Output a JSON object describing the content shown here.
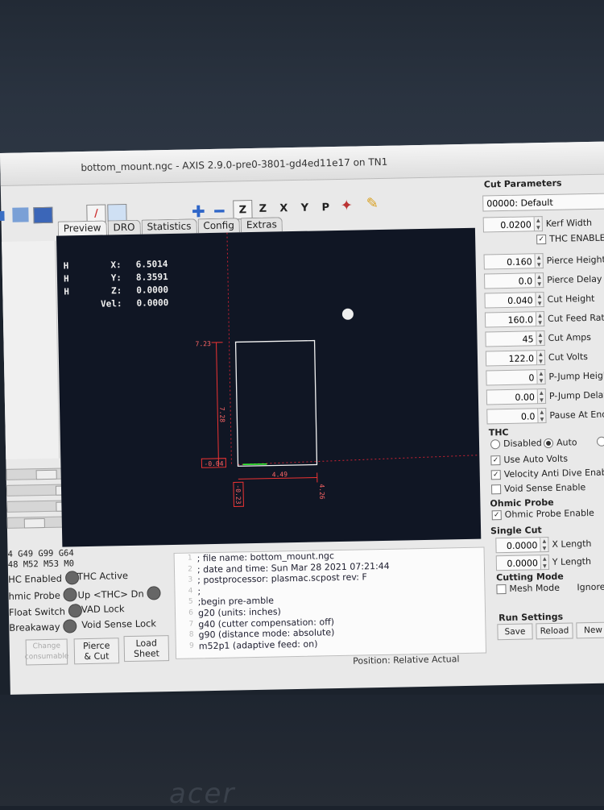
{
  "window": {
    "title": "bottom_mount.ngc - AXIS 2.9.0-pre0-3801-gd4ed11e17 on TN1"
  },
  "toolbar": {
    "view_z": "Z",
    "view_z2": "Z",
    "view_x": "X",
    "view_y": "Y",
    "view_p": "P"
  },
  "tabs": [
    "Preview",
    "DRO",
    "Statistics",
    "Config",
    "Extras"
  ],
  "dro": {
    "rows": [
      {
        "homed": "H",
        "label": "X:",
        "value": "6.5014"
      },
      {
        "homed": "H",
        "label": "Y:",
        "value": "8.3591"
      },
      {
        "homed": "H",
        "label": "Z:",
        "value": "0.0000"
      },
      {
        "homed": "",
        "label": "Vel:",
        "value": "0.0000"
      }
    ]
  },
  "preview": {
    "dims": {
      "y_top": "7.23",
      "y_size": "7.28",
      "y_min": "-0.04",
      "x_size": "4.49",
      "x_max": "4.26",
      "x_min": "-0.23"
    }
  },
  "gcodes": [
    "4 G49 G99 G64",
    "48 M52 M53 M0"
  ],
  "indicators": {
    "thc_enabled": "HC Enabled",
    "thc_active": "THC Active",
    "ohmic_probe": "hmic Probe",
    "up": "Up",
    "thc": "<THC>",
    "dn": "Dn",
    "float_switch": "Float Switch",
    "vad_lock": "VAD Lock",
    "breakaway": "Breakaway",
    "void_lock": "Void Sense Lock"
  },
  "buttons": {
    "change": "Change\nconsumable",
    "pierce": "Pierce\n& Cut",
    "load": "Load\nSheet"
  },
  "gcode_lines": [
    {
      "n": "1",
      "t": ";    file name: bottom_mount.ngc"
    },
    {
      "n": "2",
      "t": "; date and time: Sun Mar 28 2021    07:21:44"
    },
    {
      "n": "3",
      "t": "; postprocessor: plasmac.scpost rev: F"
    },
    {
      "n": "4",
      "t": ";"
    },
    {
      "n": "5",
      "t": ";begin pre-amble"
    },
    {
      "n": "6",
      "t": "g20 (units: inches)"
    },
    {
      "n": "7",
      "t": "g40 (cutter compensation: off)"
    },
    {
      "n": "8",
      "t": "g90 (distance mode: absolute)"
    },
    {
      "n": "9",
      "t": "m52p1 (adaptive feed: on)"
    }
  ],
  "position_label": "Position: Relative Actual",
  "cut_params": {
    "title": "Cut Parameters",
    "material": "00000: Default",
    "kerf": {
      "value": "0.0200",
      "label": "Kerf Width"
    },
    "thc_enable": "THC ENABLE",
    "params": [
      {
        "value": "0.160",
        "label": "Pierce Height"
      },
      {
        "value": "0.0",
        "label": "Pierce Delay"
      },
      {
        "value": "0.040",
        "label": "Cut Height"
      },
      {
        "value": "160.0",
        "label": "Cut Feed Rate"
      },
      {
        "value": "45",
        "label": "Cut Amps"
      },
      {
        "value": "122.0",
        "label": "Cut Volts"
      },
      {
        "value": "0",
        "label": "P-Jump Height"
      },
      {
        "value": "0.00",
        "label": "P-Jump Delay"
      },
      {
        "value": "0.0",
        "label": "Pause At End"
      }
    ]
  },
  "thc": {
    "title": "THC",
    "disabled": "Disabled",
    "auto": "Auto",
    "auto_volts": "Use Auto Volts",
    "vad": "Velocity Anti Dive Enable",
    "void": "Void Sense Enable"
  },
  "ohmic": {
    "title": "Ohmic Probe",
    "enable": "Ohmic Probe Enable"
  },
  "single_cut": {
    "title": "Single Cut",
    "x_value": "0.0000",
    "x_label": "X Length",
    "y_value": "0.0000",
    "y_label": "Y Length"
  },
  "cutting_mode": {
    "title": "Cutting Mode",
    "mesh": "Mesh Mode",
    "ignore": "Ignore A"
  },
  "run_settings": {
    "title": "Run Settings",
    "save": "Save",
    "reload": "Reload",
    "new": "New"
  },
  "brand": "acer"
}
